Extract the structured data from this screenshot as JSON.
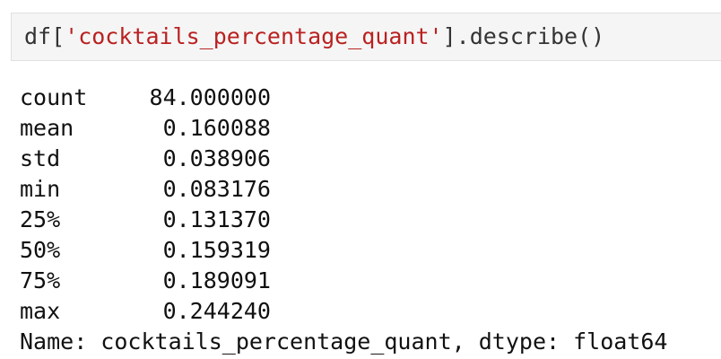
{
  "input_cell": {
    "prefix": "df[",
    "string_literal": "'cocktails_percentage_quant'",
    "suffix": "].describe()"
  },
  "output": {
    "rows": [
      {
        "label": "count",
        "value": "84.000000"
      },
      {
        "label": "mean",
        "value": "0.160088"
      },
      {
        "label": "std",
        "value": "0.038906"
      },
      {
        "label": "min",
        "value": "0.083176"
      },
      {
        "label": "25%",
        "value": "0.131370"
      },
      {
        "label": "50%",
        "value": "0.159319"
      },
      {
        "label": "75%",
        "value": "0.189091"
      },
      {
        "label": "max",
        "value": "0.244240"
      }
    ],
    "footer": "Name: cocktails_percentage_quant, dtype: float64"
  },
  "colors": {
    "cell_background": "#f5f5f5",
    "string_literal": "#ba2121",
    "text": "#333333"
  }
}
